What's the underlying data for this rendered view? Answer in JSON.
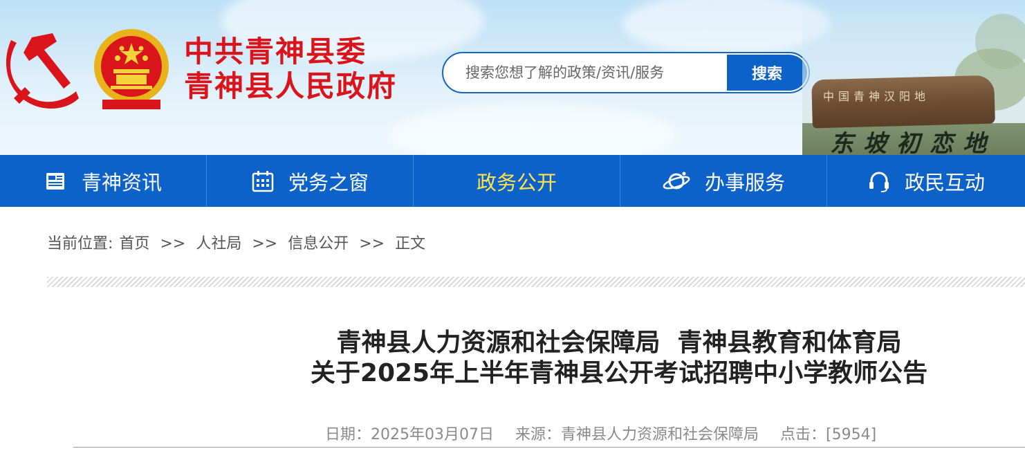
{
  "header": {
    "site_name_line1": "中共青神县委",
    "site_name_line2": "青神县人民政府",
    "search_placeholder": "搜索您想了解的政策/资讯/服务",
    "search_button": "搜索",
    "scenery_caption": "东坡初恋地",
    "stone_inscription": "中国青神汉阳地"
  },
  "nav": {
    "items": [
      {
        "label": "青神资讯",
        "icon": "news-icon"
      },
      {
        "label": "党务之窗",
        "icon": "calendar-icon"
      },
      {
        "label": "政务公开",
        "icon": "",
        "active": true
      },
      {
        "label": "办事服务",
        "icon": "planet-icon"
      },
      {
        "label": "政民互动",
        "icon": "headset-icon"
      }
    ],
    "active_color": "#ffe34d",
    "bg_color": "#0d62c9"
  },
  "breadcrumb": {
    "prefix": "当前位置:",
    "items": [
      "首页",
      "人社局",
      "信息公开",
      "正文"
    ],
    "separator": ">>"
  },
  "article": {
    "title_line1": "青神县人力资源和社会保障局  青神县教育和体育局",
    "title_line2": "关于2025年上半年青神县公开考试招聘中小学教师公告",
    "date": "日期：2025年03月07日",
    "source": "来源：青神县人力资源和社会保障局",
    "clicks": "点击：[5954]"
  }
}
